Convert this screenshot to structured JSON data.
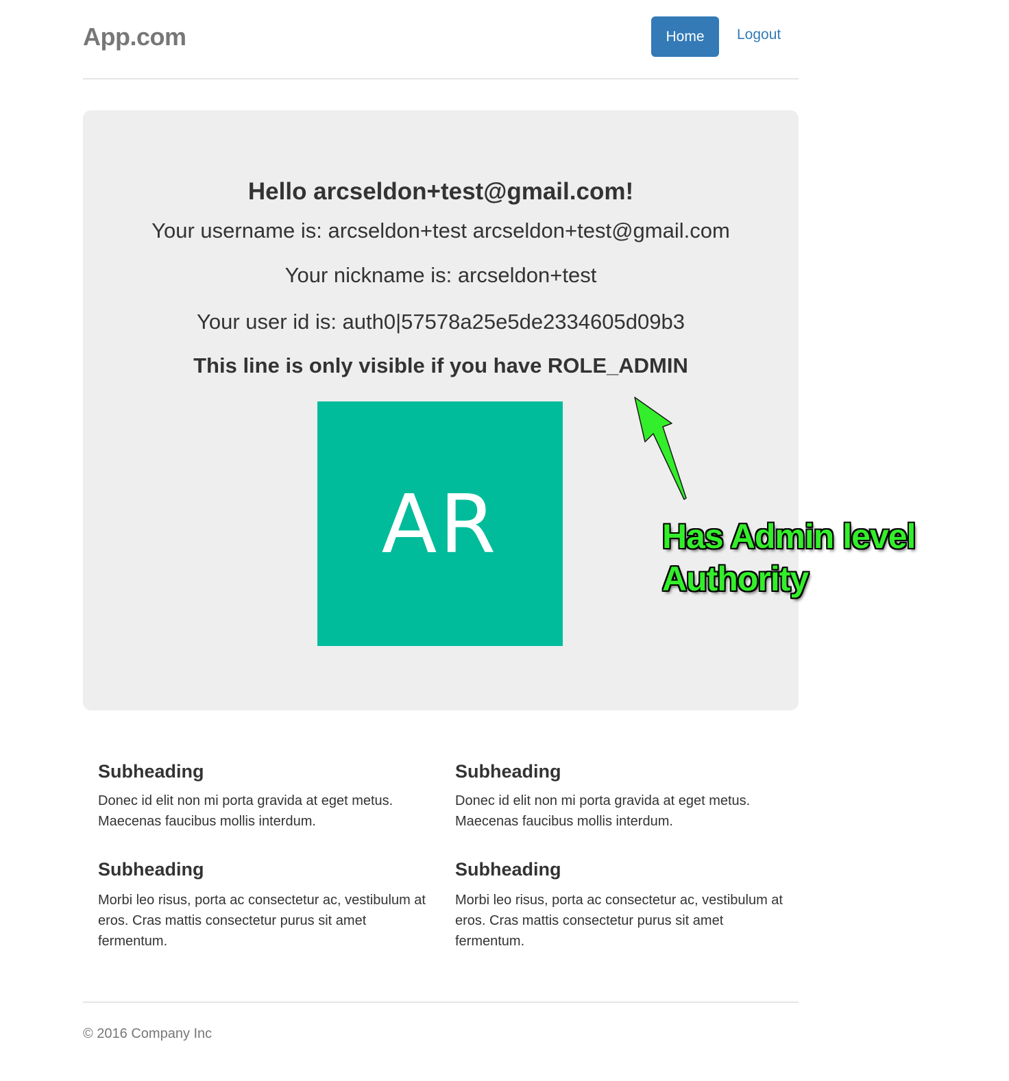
{
  "header": {
    "brand": "App.com",
    "nav": {
      "home": "Home",
      "logout": "Logout"
    }
  },
  "jumbotron": {
    "greeting": "Hello arcseldon+test@gmail.com!",
    "username_line": "Your username is: arcseldon+test arcseldon+test@gmail.com",
    "nickname_line": "Your nickname is: arcseldon+test",
    "userid_line": "Your user id is: auth0|57578a25e5de2334605d09b3",
    "admin_line": "This line is only visible if you have ROLE_ADMIN",
    "avatar_initials": "AR",
    "avatar_color": "#00bc9b"
  },
  "annotation": {
    "line1": "Has Admin level",
    "line2": "Authority",
    "color": "#33ee2a"
  },
  "sections": [
    {
      "heading": "Subheading",
      "text": "Donec id elit non mi porta gravida at eget metus. Maecenas faucibus mollis interdum."
    },
    {
      "heading": "Subheading",
      "text": "Donec id elit non mi porta gravida at eget metus. Maecenas faucibus mollis interdum."
    },
    {
      "heading": "Subheading",
      "text": "Morbi leo risus, porta ac consectetur ac, vestibulum at eros. Cras mattis consectetur purus sit amet fermentum."
    },
    {
      "heading": "Subheading",
      "text": "Morbi leo risus, porta ac consectetur ac, vestibulum at eros. Cras mattis consectetur purus sit amet fermentum."
    }
  ],
  "footer": {
    "copyright": "© 2016 Company Inc"
  },
  "colors": {
    "primary": "#337ab7",
    "jumbotron_bg": "#eeeeee"
  }
}
